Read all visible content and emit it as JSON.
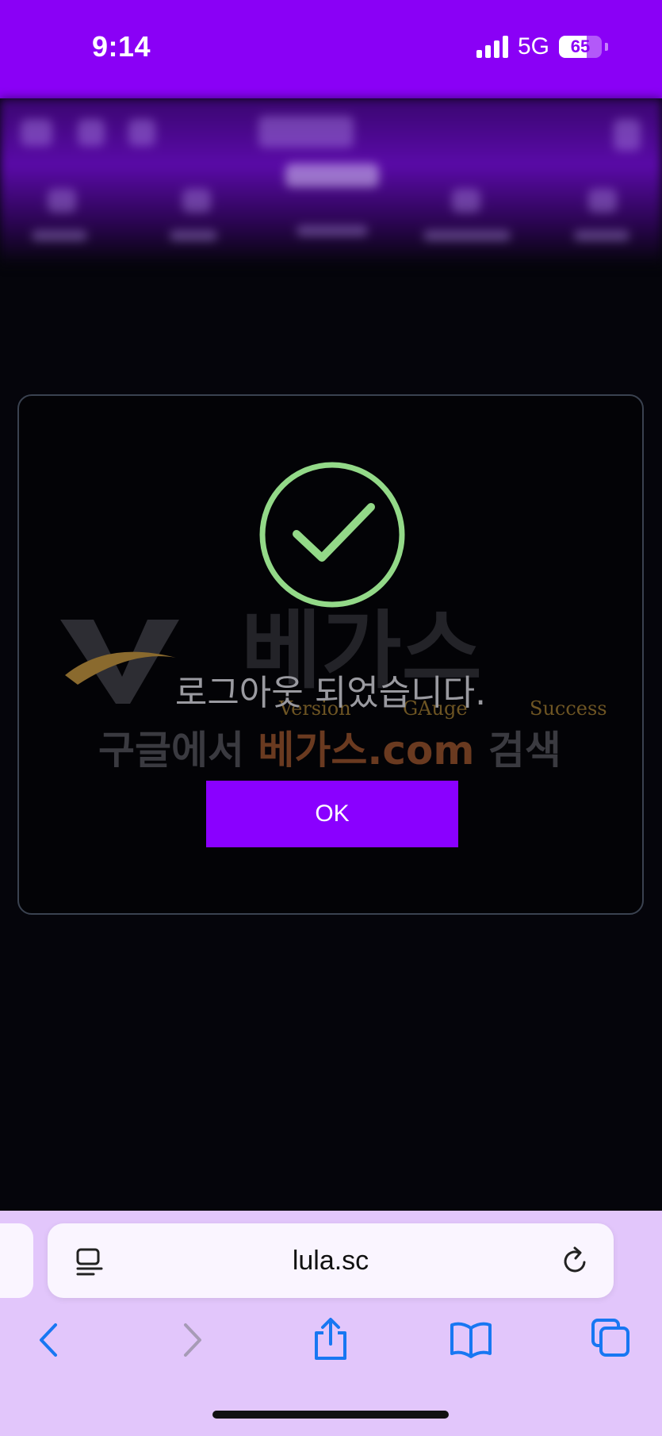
{
  "status_bar": {
    "time": "9:14",
    "network": "5G",
    "battery_level": 65,
    "battery_text": "65",
    "color": "#8a00f6"
  },
  "modal": {
    "icon": "check-circle-icon",
    "message": "로그아웃 되었습니다.",
    "ok_label": "OK",
    "watermark": {
      "brand": "베가스",
      "words": [
        "Version",
        "GAuge",
        "Success"
      ],
      "search_prefix": "구글에서 ",
      "search_site": "베가스.com",
      "search_suffix": " 검색"
    },
    "accent_color": "#8a00ff",
    "check_color": "#93d988"
  },
  "browser": {
    "url": "lula.sc",
    "reader_icon": "reader-icon",
    "reload_icon": "reload-icon",
    "toolbar": [
      "back-icon",
      "forward-icon",
      "share-icon",
      "bookmarks-icon",
      "tabs-icon"
    ]
  }
}
